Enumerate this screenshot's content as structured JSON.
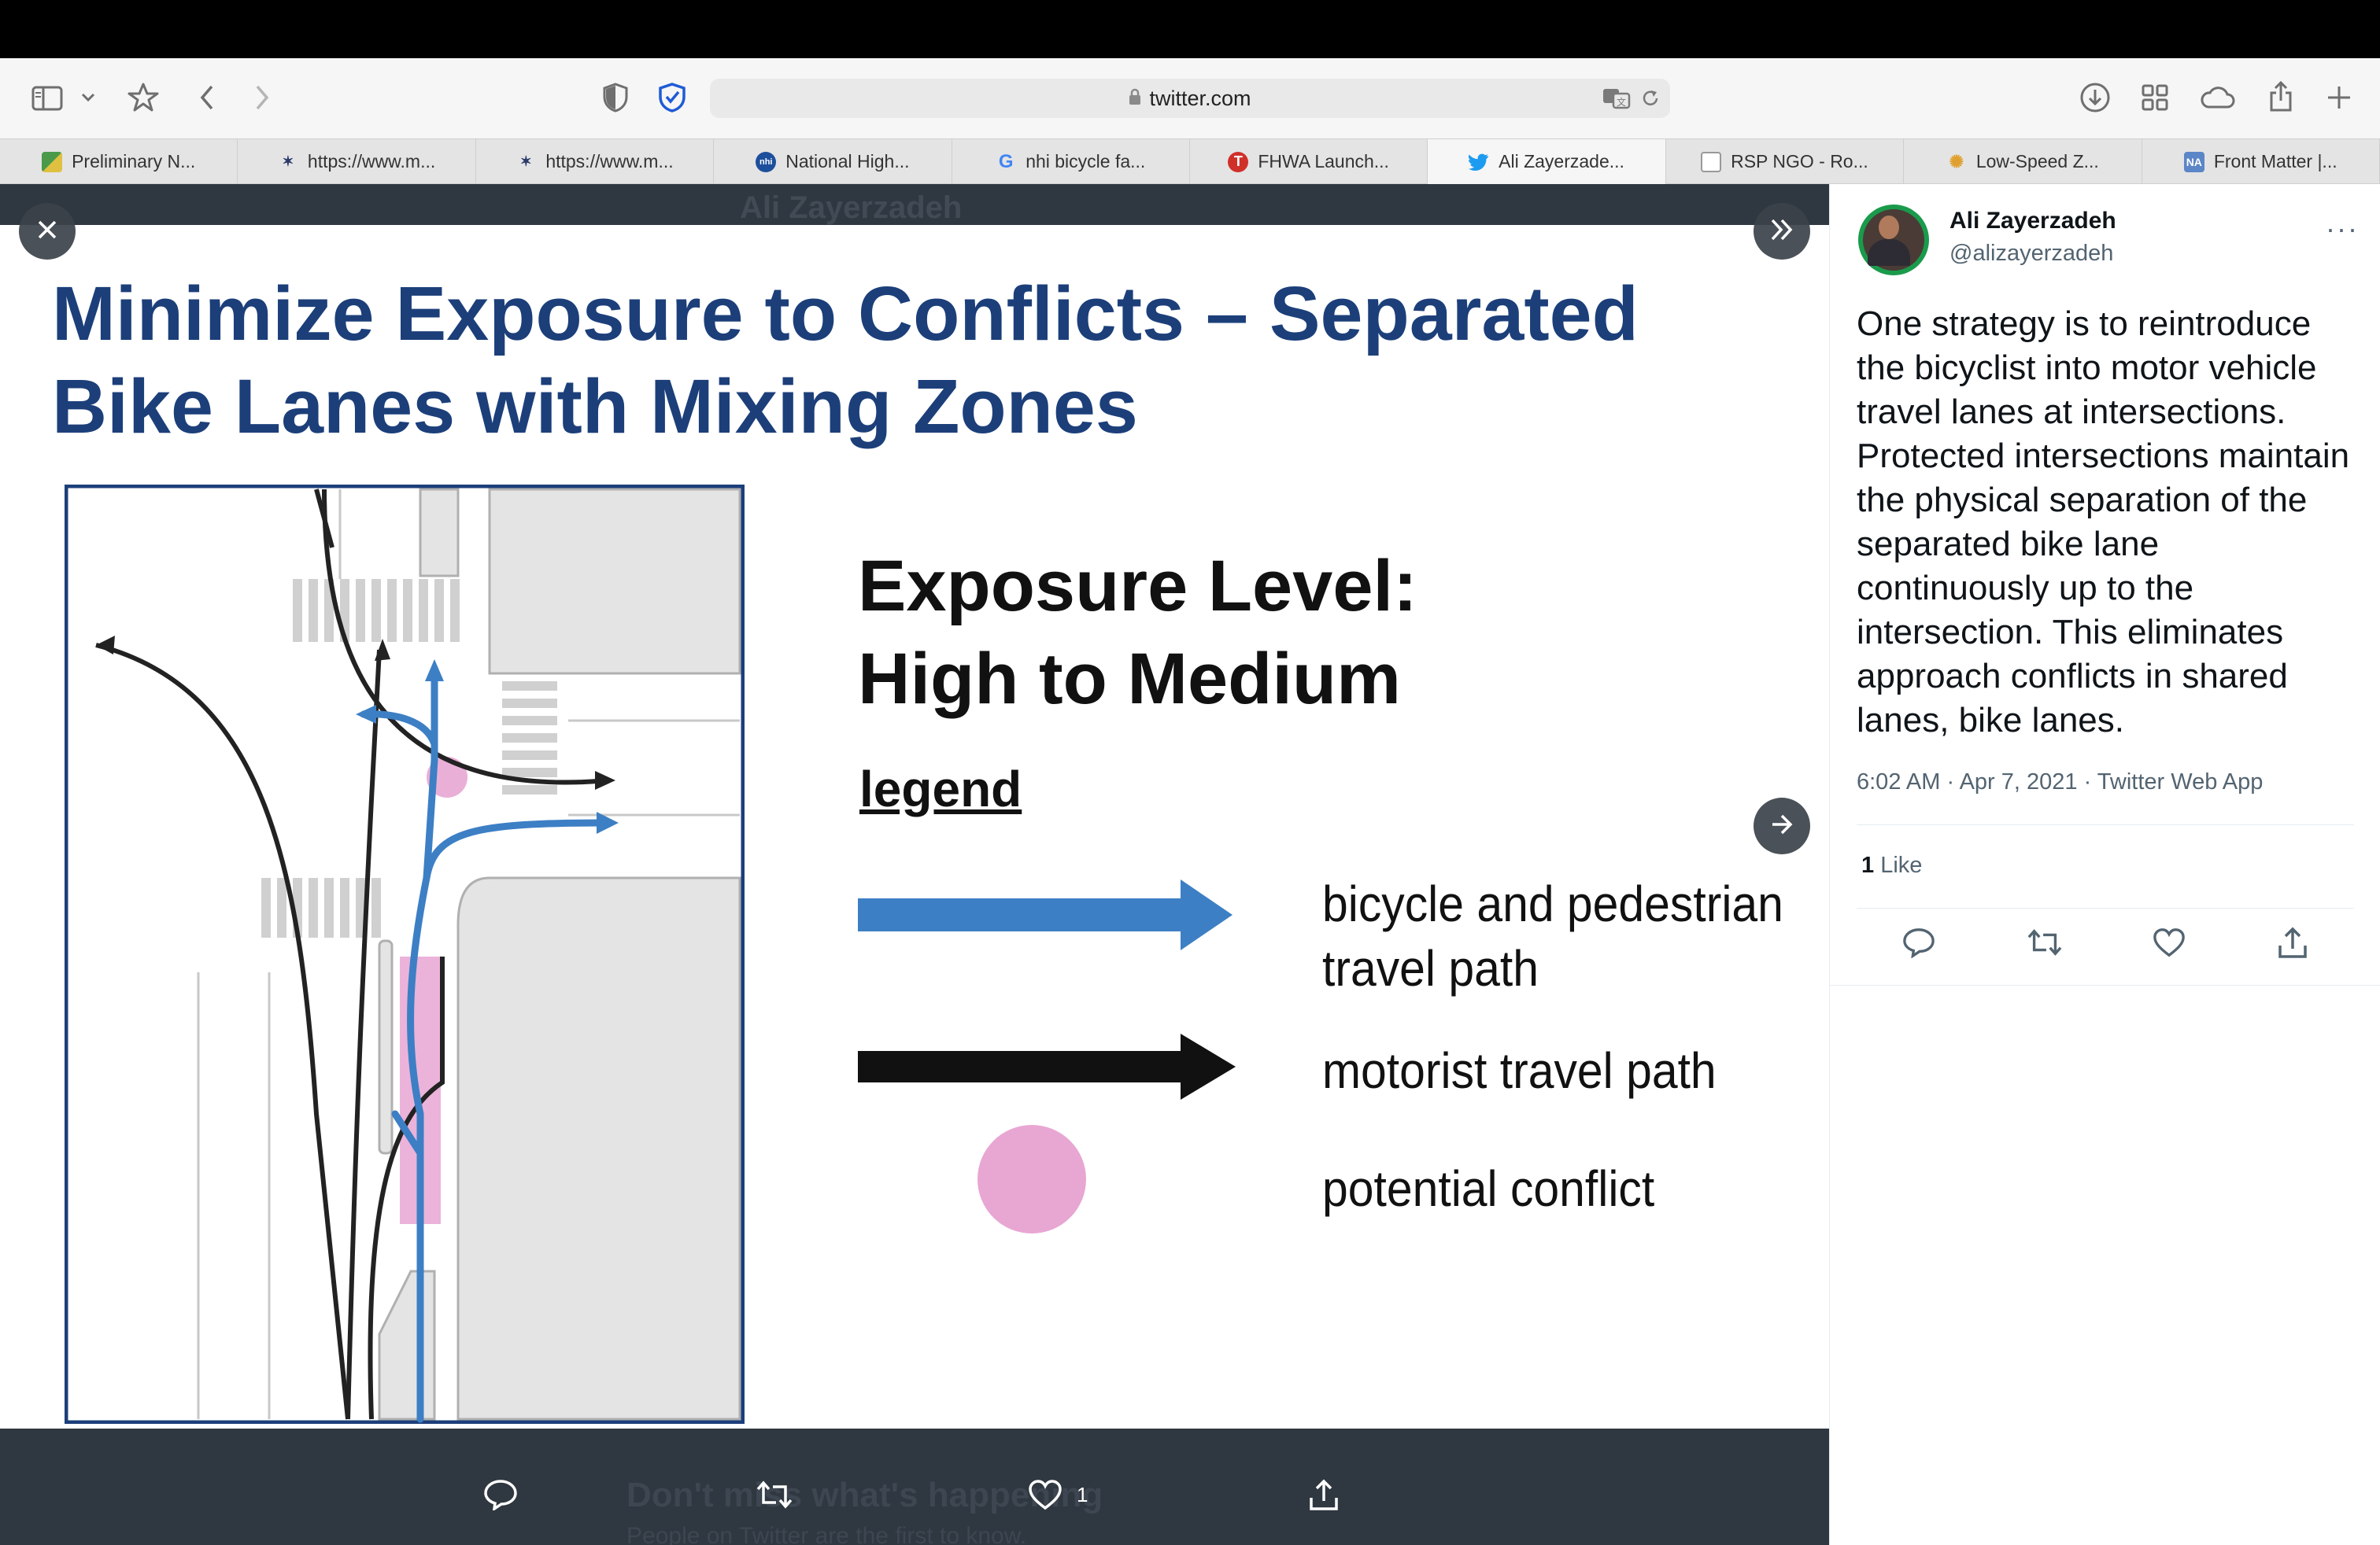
{
  "browser": {
    "url": "twitter.com",
    "tabs": [
      {
        "label": "Preliminary N...",
        "favicon": "map-favicon",
        "active": false
      },
      {
        "label": "https://www.m...",
        "favicon": "compass-favicon",
        "active": false
      },
      {
        "label": "https://www.m...",
        "favicon": "compass-favicon",
        "active": false
      },
      {
        "label": "National High...",
        "favicon": "nhi-favicon",
        "active": false
      },
      {
        "label": "nhi bicycle fa...",
        "favicon": "google-favicon",
        "active": false
      },
      {
        "label": "FHWA Launch...",
        "favicon": "t-favicon",
        "active": false
      },
      {
        "label": "Ali Zayerzade...",
        "favicon": "twitter-favicon",
        "active": true
      },
      {
        "label": "RSP NGO - Ro...",
        "favicon": "doc-favicon",
        "active": false
      },
      {
        "label": "Low-Speed Z...",
        "favicon": "dots-favicon",
        "active": false
      },
      {
        "label": "Front Matter |...",
        "favicon": "na-favicon",
        "active": false
      }
    ]
  },
  "viewer": {
    "ghost_name": "Ali Zayerzadeh",
    "ghost_banner_title": "Don't miss what's happening",
    "ghost_banner_sub": "People on Twitter are the first to know.",
    "retweet_count": "",
    "like_count": "1"
  },
  "slide": {
    "title_line1": "Minimize Exposure to Conflicts – Separated",
    "title_line2": "Bike Lanes with Mixing Zones",
    "exposure_line1": "Exposure  Level:",
    "exposure_line2": "High to Medium",
    "legend_label": "legend",
    "legend_bike_line1": "bicycle and pedestrian",
    "legend_bike_line2": "travel path",
    "legend_motor": "motorist travel path",
    "legend_conflict": "potential conflict",
    "colors": {
      "title": "#1c3f7a",
      "bike_arrow": "#3d7fc4",
      "conflict": "#e8a6d3"
    }
  },
  "tweet": {
    "display_name": "Ali Zayerzadeh",
    "handle": "@alizayerzadeh",
    "more_label": "···",
    "text": "One strategy is to reintroduce the bicyclist into motor vehicle travel lanes at intersections. Protected intersections maintain the physical separation of the separated bike lane continuously up to the intersection. This eliminates approach conflicts in shared lanes, bike lanes.",
    "meta": "6:02 AM · Apr 7, 2021 · Twitter Web App",
    "like_count": "1",
    "like_label": " Like"
  }
}
